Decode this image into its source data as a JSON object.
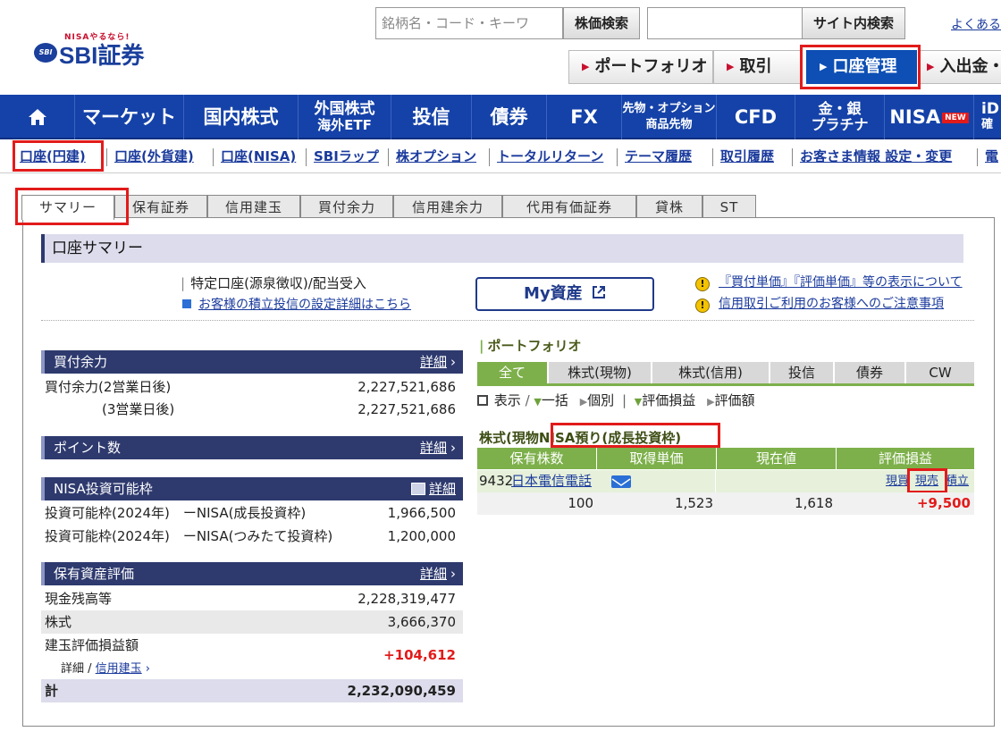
{
  "header": {
    "logo_tagline": "NISAやるなら!",
    "logo_mark": "SBI",
    "logo_brand": "SBI証券",
    "search_placeholder": "銘柄名・コード・キーワ",
    "stock_search_button": "株価検索",
    "site_search_button": "サイト内検索",
    "faq_link": "よくある",
    "primary_buttons": [
      "ポートフォリオ",
      "取引",
      "口座管理",
      "入出金・"
    ]
  },
  "global_nav": [
    "マーケット",
    "国内株式",
    "外国株式",
    "海外ETF",
    "投信",
    "債券",
    "FX",
    "先物・オプション",
    "商品先物",
    "CFD",
    "金・銀",
    "プラチナ",
    "NISA",
    "NEW",
    "iD",
    "確"
  ],
  "sub_nav": [
    "口座(円建)",
    "口座(外貨建)",
    "口座(NISA)",
    "SBIラップ",
    "株オプション",
    "トータルリターン",
    "テーマ履歴",
    "取引履歴",
    "お客さま情報 設定・変更",
    "電"
  ],
  "tabs": [
    "サマリー",
    "保有証券",
    "信用建玉",
    "買付余力",
    "信用建余力",
    "代用有価証券",
    "貸株",
    "ST"
  ],
  "summary": {
    "title": "口座サマリー",
    "account_type": "特定口座(源泉徴収)/配当受入",
    "tsumitate_link": "お客様の積立投信の設定詳細はこちら",
    "my_asset_button": "My資産",
    "notice_1": "『買付単価』『評価単価』等の表示について",
    "notice_2": "信用取引ご利用のお客様へのご注意事項"
  },
  "buying_power": {
    "header": "買付余力",
    "detail": "詳細",
    "rows": [
      {
        "label": "買付余力(2営業日後)",
        "value": "2,227,521,686"
      },
      {
        "label": "(3営業日後)",
        "value": "2,227,521,686"
      }
    ]
  },
  "points": {
    "header": "ポイント数",
    "detail": "詳細"
  },
  "nisa": {
    "header": "NISA投資可能枠",
    "detail": "詳細",
    "rows": [
      {
        "label": "投資可能枠(2024年)　ーNISA(成長投資枠)",
        "value": "1,966,500"
      },
      {
        "label": "投資可能枠(2024年)　ーNISA(つみたて投資枠)",
        "value": "1,200,000"
      }
    ]
  },
  "holdings": {
    "header": "保有資産評価",
    "detail": "詳細",
    "rows": [
      {
        "label": "現金残高等",
        "value": "2,228,319,477"
      },
      {
        "label": "株式",
        "value": "3,666,370"
      },
      {
        "label": "建玉評価損益額",
        "value": "+104,612"
      }
    ],
    "sub_label": "詳細 /",
    "sub_link": "信用建玉",
    "total_label": "計",
    "total_value": "2,232,090,459"
  },
  "portfolio": {
    "title": "ポートフォリオ",
    "tabs": [
      "全て",
      "株式(現物)",
      "株式(信用)",
      "投信",
      "債券",
      "CW"
    ],
    "tools": [
      "表示",
      "/",
      "一括",
      "個別",
      "|",
      "評価損益",
      "評価額"
    ],
    "section_prefix": "株式(現物",
    "section_highlight": "NISA預り(成長投資枠",
    "section_suffix": ")",
    "columns": [
      "保有株数",
      "取得単価",
      "現在値",
      "評価損益"
    ],
    "stock_code": "9432",
    "stock_name": "日本電信電話",
    "actions": [
      "現買",
      "現売",
      "積立"
    ],
    "quantity": "100",
    "acquisition_price": "1,523",
    "current_price": "1,618",
    "profit_loss": "+9,500"
  }
}
